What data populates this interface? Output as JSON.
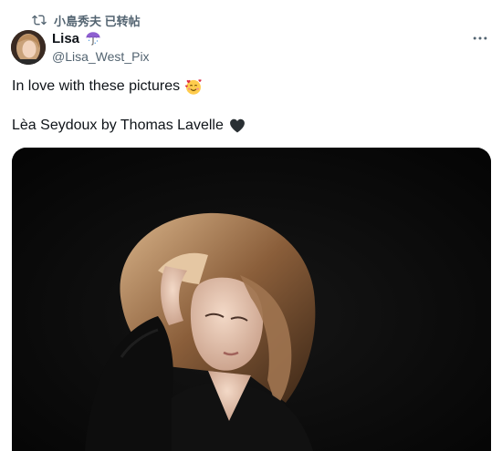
{
  "retweet": {
    "label": "小島秀夫 已转帖",
    "icon": "retweet-icon"
  },
  "author": {
    "display_name": "Lisa",
    "handle": "@Lisa_West_Pix",
    "name_emoji": "umbrella-icon",
    "avatar": "avatar"
  },
  "tweet": {
    "line1": "In love with these pictures",
    "line1_emoji": "smiling-face-with-hearts-icon",
    "line2": "Lèa Seydoux by Thomas Lavelle",
    "line2_emoji": "black-heart-icon"
  },
  "media": {
    "kind": "photo",
    "background": "#0a0a0a"
  },
  "colors": {
    "text": "#0f1419",
    "secondary": "#536471"
  }
}
